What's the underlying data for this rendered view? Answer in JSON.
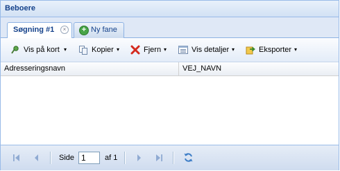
{
  "panel": {
    "title": "Beboere"
  },
  "tabs": [
    {
      "label": "Søgning #1",
      "close": "×"
    },
    {
      "label": "Ny fane",
      "add": "+"
    }
  ],
  "toolbar": {
    "show_on_map": "Vis på kort",
    "copy": "Kopier",
    "remove": "Fjern",
    "show_details": "Vis detaljer",
    "export": "Eksporter",
    "dropdown_arrow": "▾"
  },
  "grid": {
    "columns": [
      "Adresseringsnavn",
      "VEJ_NAVN"
    ],
    "rows": []
  },
  "pager": {
    "page_label": "Side",
    "page_value": "1",
    "of_label": "af 1"
  },
  "colors": {
    "header_text": "#15428b",
    "border": "#99bbe8",
    "pager_icon": "#7f9fcf"
  }
}
